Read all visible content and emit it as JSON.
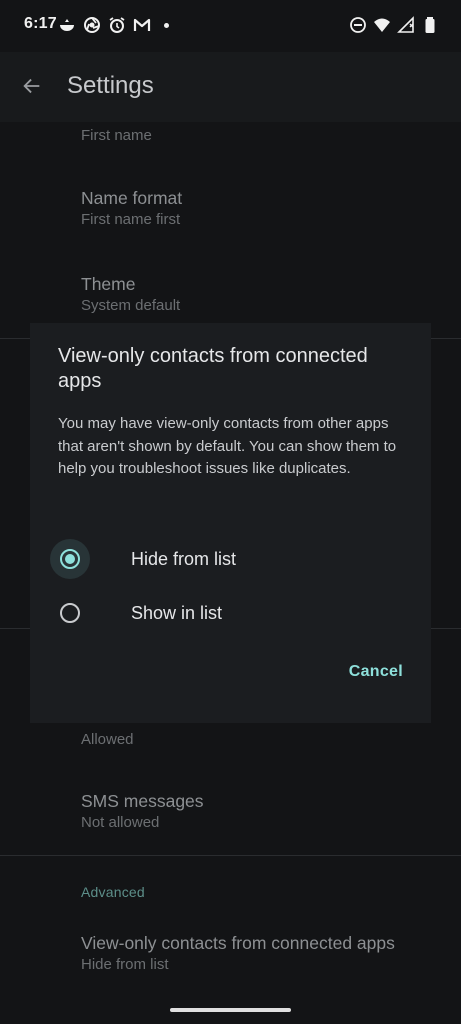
{
  "status_bar": {
    "time": "6:17",
    "left_icons": [
      "cat-app-icon",
      "chrome-like-icon",
      "alarm-icon",
      "gmail-icon",
      "notification-dot-icon"
    ],
    "right_icons": [
      "do-not-disturb-icon",
      "wifi-icon",
      "cell-signal-icon",
      "battery-icon"
    ]
  },
  "app_bar": {
    "title": "Settings"
  },
  "settings": {
    "sort_sub": "First name",
    "name_format_title": "Name format",
    "name_format_sub": "First name first",
    "theme_title": "Theme",
    "theme_sub": "System default",
    "contacts_sub": "Allowed",
    "sms_title": "SMS messages",
    "sms_sub": "Not allowed",
    "advanced_header": "Advanced",
    "view_only_title": "View-only contacts from connected apps",
    "view_only_sub": "Hide from list"
  },
  "dialog": {
    "title": "View-only contacts from connected apps",
    "body": "You may have view-only contacts from other apps that aren't shown by default. You can show them to help you troubleshoot issues like duplicates.",
    "options": [
      {
        "label": "Hide from list",
        "selected": true
      },
      {
        "label": "Show in list",
        "selected": false
      }
    ],
    "cancel": "Cancel"
  },
  "colors": {
    "accent": "#8ee0db",
    "background": "#131416",
    "dialog": "#1b1d20"
  }
}
